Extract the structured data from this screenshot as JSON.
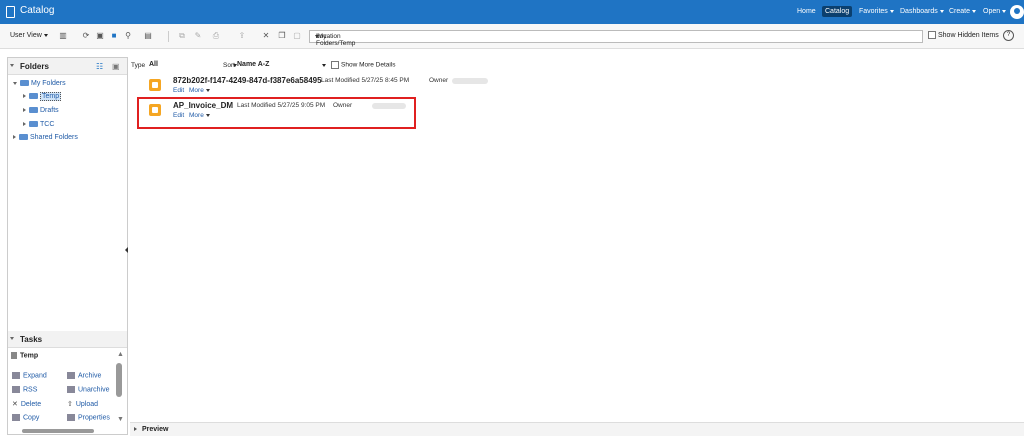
{
  "header": {
    "title": "Catalog",
    "nav": [
      {
        "label": "Home",
        "active": false
      },
      {
        "label": "Catalog",
        "active": true
      },
      {
        "label": "Favorites",
        "active": false,
        "dropdown": true
      },
      {
        "label": "Dashboards",
        "active": false,
        "dropdown": true
      },
      {
        "label": "Create",
        "active": false,
        "dropdown": true
      },
      {
        "label": "Open",
        "active": false,
        "dropdown": true
      }
    ],
    "brand_color": "#1f74c4"
  },
  "toolbar": {
    "user_view_label": "User View",
    "location_label": "Location",
    "location_path": "/My Folders/Temp",
    "show_hidden_label": "Show Hidden Items"
  },
  "folders_panel": {
    "title": "Folders",
    "tree": [
      {
        "label": "My Folders",
        "level": 0,
        "expanded": true
      },
      {
        "label": "Temp",
        "level": 1,
        "selected": true
      },
      {
        "label": "Drafts",
        "level": 1
      },
      {
        "label": "TCC",
        "level": 1
      },
      {
        "label": "Shared Folders",
        "level": 0
      }
    ]
  },
  "tasks_panel": {
    "title": "Tasks",
    "current": "Temp",
    "actions": [
      [
        "Expand",
        "Archive"
      ],
      [
        "RSS",
        "Unarchive"
      ],
      [
        "Delete",
        "Upload"
      ],
      [
        "Copy",
        "Properties"
      ]
    ]
  },
  "filters": {
    "type_label": "Type",
    "type_value": "All",
    "sort_label": "Sort",
    "sort_value": "Name A-Z",
    "show_more_label": "Show More Details"
  },
  "items": [
    {
      "name": "872b202f-f147-4249-847d-f387e6a58495",
      "last_modified": "Last Modified 5/27/25 8:45 PM",
      "owner_label": "Owner",
      "edit": "Edit",
      "more": "More"
    },
    {
      "name": "AP_Invoice_DM",
      "last_modified": "Last Modified 5/27/25 9:05 PM",
      "owner_label": "Owner",
      "edit": "Edit",
      "more": "More"
    }
  ],
  "preview": {
    "label": "Preview"
  }
}
